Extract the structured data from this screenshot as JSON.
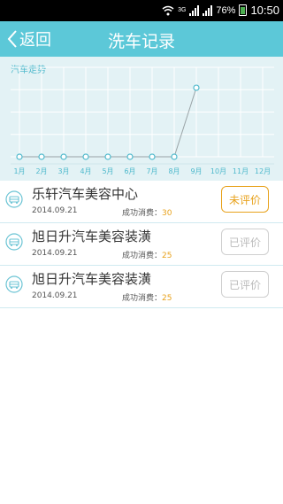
{
  "status_bar": {
    "battery": "76%",
    "time": "10:50",
    "network": "3G"
  },
  "header": {
    "back_label": "返回",
    "title": "洗车记录",
    "color": "#5cc8d8"
  },
  "chart_data": {
    "type": "line",
    "title": "汽车走势",
    "categories": [
      "1月",
      "2月",
      "3月",
      "4月",
      "5月",
      "6月",
      "7月",
      "8月",
      "9月",
      "10月",
      "11月",
      "12月"
    ],
    "series": [
      {
        "values": [
          0,
          0,
          0,
          0,
          0,
          0,
          0,
          0,
          55
        ]
      }
    ],
    "ylim": [
      0,
      60
    ],
    "grid": true,
    "colors": {
      "point": "#4fb9cc",
      "line": "#9aa3a6",
      "label": "#4fb9cc"
    }
  },
  "records": [
    {
      "name": "乐轩汽车美容中心",
      "date": "2014.09.21",
      "spend_label": "成功消费：",
      "amount": "30",
      "status": "未评价",
      "state": "pending"
    },
    {
      "name": "旭日升汽车美容装潢",
      "date": "2014.09.21",
      "spend_label": "成功消费：",
      "amount": "25",
      "status": "已评价",
      "state": "done"
    },
    {
      "name": "旭日升汽车美容装潢",
      "date": "2014.09.21",
      "spend_label": "成功消费：",
      "amount": "25",
      "status": "已评价",
      "state": "done"
    }
  ]
}
